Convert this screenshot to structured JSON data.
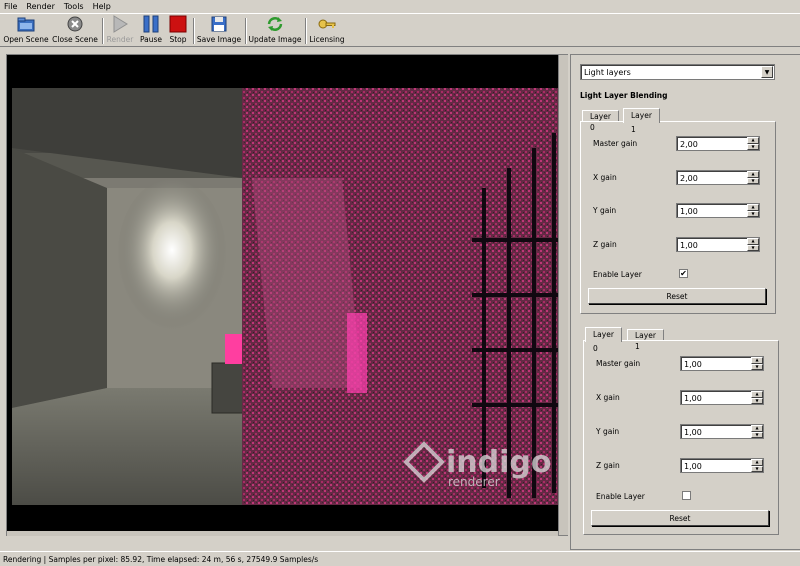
{
  "menu": [
    "File",
    "Render",
    "Tools",
    "Help"
  ],
  "toolbar": {
    "open_scene": "Open Scene",
    "close_scene": "Close Scene",
    "render": "Render",
    "pause": "Pause",
    "stop": "Stop",
    "save_image": "Save Image",
    "update_image": "Update Image",
    "licensing": "Licensing"
  },
  "render_view": {
    "watermark_main": "indigo",
    "watermark_sub": "renderer"
  },
  "panel": {
    "mode_select": "Light layers",
    "section_title": "Light Layer Blending",
    "upper": {
      "tabs": [
        "Layer 0",
        "Layer 1"
      ],
      "active_tab": "Layer 1",
      "master_gain_label": "Master gain",
      "master_gain": "2,00",
      "x_gain_label": "X gain",
      "x_gain": "2,00",
      "y_gain_label": "Y gain",
      "y_gain": "1,00",
      "z_gain_label": "Z gain",
      "z_gain": "1,00",
      "enable_label": "Enable Layer",
      "enable_checked": "✔",
      "reset": "Reset"
    },
    "lower": {
      "tabs": [
        "Layer 0",
        "Layer 1"
      ],
      "active_tab": "Layer 0",
      "master_gain_label": "Master gain",
      "master_gain": "1,00",
      "x_gain_label": "X gain",
      "x_gain": "1,00",
      "y_gain_label": "Y gain",
      "y_gain": "1,00",
      "z_gain_label": "Z gain",
      "z_gain": "1,00",
      "enable_label": "Enable Layer",
      "enable_checked": "",
      "reset": "Reset"
    }
  },
  "status": "Rendering | Samples per pixel: 85.92, Time elapsed: 24 m, 56 s, 27549.9 Samples/s",
  "colors": {
    "accent_pink": "#e23c8c",
    "stop_red": "#cc1111",
    "pause_blue": "#3a6fc8",
    "window_bg": "#d4d0c8"
  }
}
